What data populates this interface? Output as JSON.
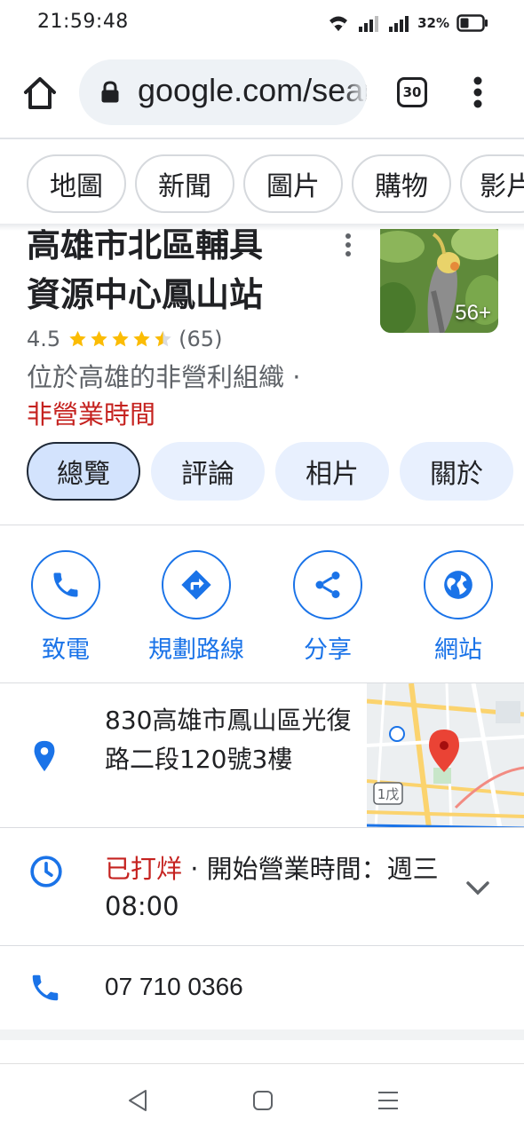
{
  "status_bar": {
    "time": "21:59:48",
    "battery": "32%"
  },
  "browser": {
    "url": "google.com/search",
    "tab_count": "30",
    "icons": [
      "home-icon",
      "lock-icon",
      "tabs-icon",
      "menu-dots-icon"
    ]
  },
  "filter_chips": [
    "地圖",
    "新聞",
    "圖片",
    "購物",
    "影片"
  ],
  "place": {
    "title_line1": "高雄市北區輔具",
    "title_line2": "資源中心鳳山站",
    "photo_count": "56+",
    "rating": "4.5",
    "star_rating": 4.5,
    "reviews_count": "(65)",
    "description": "位於高雄的非營利組織 · ",
    "status": "非營業時間",
    "colors": {
      "closed": "#c5221f",
      "action": "#1a73e8",
      "star": "#fbbc04"
    }
  },
  "section_tabs": [
    "總覽",
    "評論",
    "相片",
    "關於"
  ],
  "actions": [
    {
      "label": "致電",
      "icon": "phone-icon"
    },
    {
      "label": "規劃路線",
      "icon": "directions-icon"
    },
    {
      "label": "分享",
      "icon": "share-icon"
    },
    {
      "label": "網站",
      "icon": "globe-icon"
    }
  ],
  "info": {
    "address": "830高雄市鳳山區光復路二段120號3樓",
    "hours_status": "已打烊",
    "hours_detail": " · 開始營業時間：週三08:00",
    "phone": "07 710 0366",
    "map_label": "1戊"
  }
}
